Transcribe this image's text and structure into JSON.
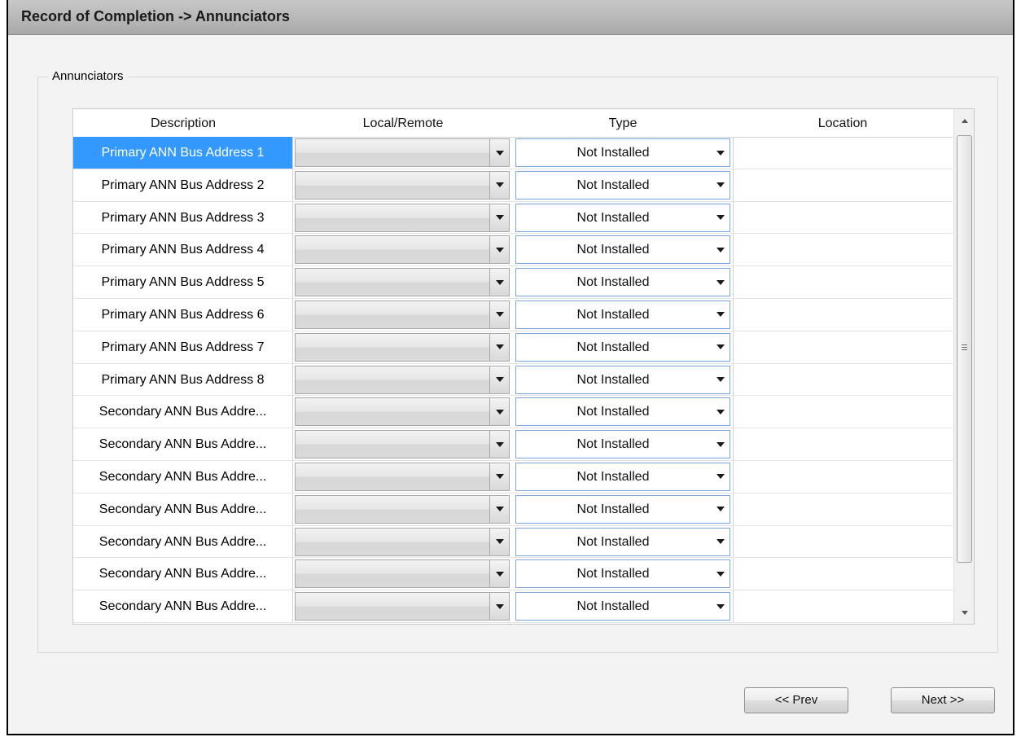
{
  "window": {
    "title": "Record of Completion -> Annunciators"
  },
  "group": {
    "legend": "Annunciators"
  },
  "grid": {
    "columns": [
      "Description",
      "Local/Remote",
      "Type",
      "Location"
    ],
    "rows": [
      {
        "description": "Primary ANN Bus Address 1",
        "local_remote": "",
        "type": "Not Installed",
        "location": ""
      },
      {
        "description": "Primary ANN Bus Address 2",
        "local_remote": "",
        "type": "Not Installed",
        "location": ""
      },
      {
        "description": "Primary ANN Bus Address 3",
        "local_remote": "",
        "type": "Not Installed",
        "location": ""
      },
      {
        "description": "Primary ANN Bus Address 4",
        "local_remote": "",
        "type": "Not Installed",
        "location": ""
      },
      {
        "description": "Primary ANN Bus Address 5",
        "local_remote": "",
        "type": "Not Installed",
        "location": ""
      },
      {
        "description": "Primary ANN Bus Address 6",
        "local_remote": "",
        "type": "Not Installed",
        "location": ""
      },
      {
        "description": "Primary ANN Bus Address 7",
        "local_remote": "",
        "type": "Not Installed",
        "location": ""
      },
      {
        "description": "Primary ANN Bus Address 8",
        "local_remote": "",
        "type": "Not Installed",
        "location": ""
      },
      {
        "description": "Secondary ANN Bus Addre...",
        "local_remote": "",
        "type": "Not Installed",
        "location": ""
      },
      {
        "description": "Secondary ANN Bus Addre...",
        "local_remote": "",
        "type": "Not Installed",
        "location": ""
      },
      {
        "description": "Secondary ANN Bus Addre...",
        "local_remote": "",
        "type": "Not Installed",
        "location": ""
      },
      {
        "description": "Secondary ANN Bus Addre...",
        "local_remote": "",
        "type": "Not Installed",
        "location": ""
      },
      {
        "description": "Secondary ANN Bus Addre...",
        "local_remote": "",
        "type": "Not Installed",
        "location": ""
      },
      {
        "description": "Secondary ANN Bus Addre...",
        "local_remote": "",
        "type": "Not Installed",
        "location": ""
      },
      {
        "description": "Secondary ANN Bus Addre...",
        "local_remote": "",
        "type": "Not Installed",
        "location": ""
      }
    ],
    "selected_row": 0
  },
  "buttons": {
    "prev": "<< Prev",
    "next": "Next >>"
  },
  "colors": {
    "selection": "#3399ff",
    "titlebar": "#b3b3b3"
  },
  "icons": {
    "dropdown": "chevron-down-icon",
    "scroll_up": "scroll-up-icon",
    "scroll_down": "scroll-down-icon"
  }
}
